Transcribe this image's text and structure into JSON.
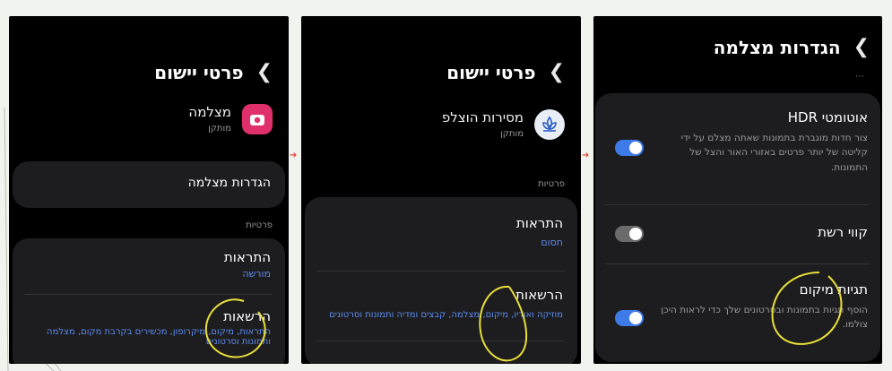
{
  "panel1": {
    "title": "פרטי יישום",
    "app_name": "מצלמה",
    "app_status": "מותקן",
    "settings_button": "הגדרות מצלמה",
    "section_label": "פרטיות",
    "notifications_title": "התראות",
    "notifications_value": "מורשה",
    "permissions_title": "הרשאות",
    "permissions_line1": "התראות, מיקום, מיקרופון, מכשירים בקרבת מקום, מצלמה",
    "permissions_line2": "ותמונות וסרטונים"
  },
  "panel2": {
    "title": "פרטי יישום",
    "app_name": "מסירות הוצלפ",
    "app_status": "מותקן",
    "section_label": "פרטיות",
    "notifications_title": "התראות",
    "notifications_value": "חסום",
    "permissions_title": "הרשאות",
    "permissions_value": "מוזיקה ואודיו, מיקום, מצלמה, קבצים ומדיה ותמונות וסרטונים"
  },
  "panel3": {
    "title": "הגדרות מצלמה",
    "hdr_title": "HDR אוטומטי",
    "hdr_desc": "צור חדות מוגברת בתמונות שאתה מצלם על ידי קליטה של יותר פרטים באזורי האור והצל של התמונות.",
    "hdr_on": true,
    "grid_title": "קווי רשת",
    "grid_on": false,
    "location_title": "תגיות מיקום",
    "location_desc": "הוסף תגיות בתמונות ובסרטונים שלך כדי לראות היכן צולמו.",
    "location_on": true
  },
  "colors": {
    "accent_blue": "#3f7be8",
    "toggle_off": "#6b6b6b",
    "annotation": "#e8df3a",
    "arrow": "#e04a3a",
    "camera_icon": "#e0306b"
  }
}
